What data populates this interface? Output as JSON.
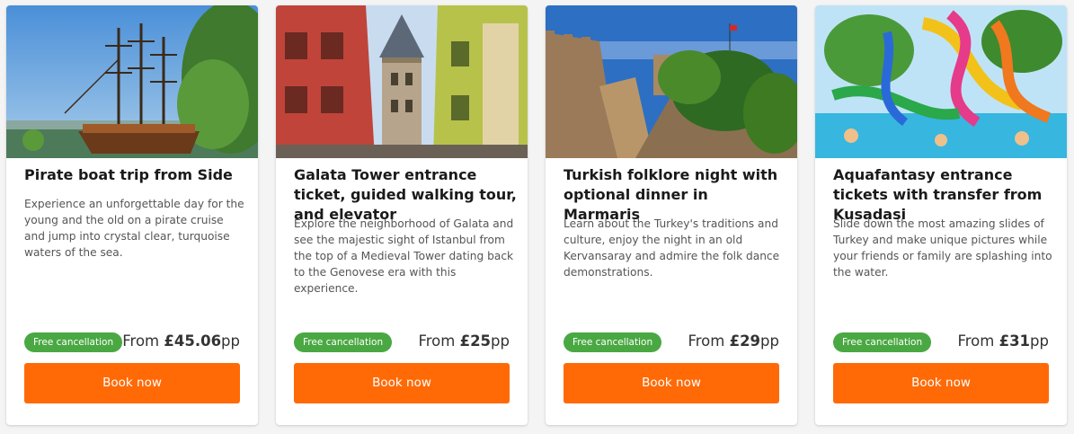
{
  "common": {
    "badge_label": "Free cancellation",
    "price_prefix": "From",
    "price_suffix": "pp",
    "button_label": "Book now"
  },
  "cards": [
    {
      "title": "Pirate boat trip from Side",
      "description": "Experience an unforgettable day for the young and the old on a pirate cruise and jump into crystal clear, turquoise waters of the sea.",
      "price": "£45.06",
      "image_subject": "pirate ship with tall masts near a green tree under blue sky"
    },
    {
      "title": "Galata Tower entrance ticket, guided walking tour, and elevator",
      "description": "Explore the neighborhood of Galata and see the majestic sight of Istanbul from the top of a Medieval Tower dating back to the Genovese era with this experience.",
      "price": "£25",
      "image_subject": "Galata Tower at end of colourful street"
    },
    {
      "title": "Turkish folklore night with optional dinner in Marmaris",
      "description": "Learn about the Turkey's traditions and culture, enjoy the night in an old Kervansaray and admire the folk dance demonstrations.",
      "price": "£29",
      "image_subject": "castle stone walls with palm trees"
    },
    {
      "title": "Aquafantasy entrance tickets with transfer from Kusadasi",
      "description": "Slide down the most amazing slides of Turkey and make unique pictures while your friends or family are splashing into the water.",
      "price": "£31",
      "image_subject": "colourful waterpark slides and pool"
    }
  ],
  "colors": {
    "badge_green": "#4aa843",
    "button_orange": "#ff6a06"
  }
}
